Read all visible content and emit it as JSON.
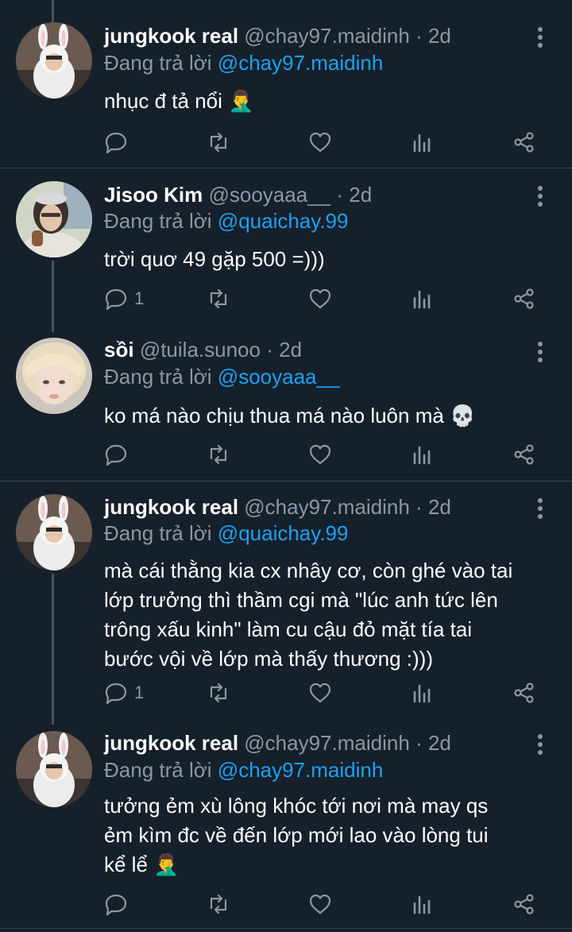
{
  "reply_prefix": "Đang trả lời",
  "tweets": [
    {
      "name": "jungkook real",
      "handle": "@chay97.maidinh",
      "time": "2d",
      "reply_to": "@chay97.maidinh",
      "text": "nhục đ tả nổi 🤦‍♂️",
      "reply_count": "",
      "avatar": "bunny-costume-boy"
    },
    {
      "name": "Jisoo Kim",
      "handle": "@sooyaaa__",
      "time": "2d",
      "reply_to": "@quaichay.99",
      "text": "trời quơ 49 gặp 500 =)))",
      "reply_count": "1",
      "avatar": "girl-with-hat"
    },
    {
      "name": "sồi",
      "handle": "@tuila.sunoo",
      "time": "2d",
      "reply_to": "@sooyaaa__",
      "text": "ko má nào chịu thua má nào luôn mà 💀",
      "reply_count": "",
      "avatar": "blond-boy"
    },
    {
      "name": "jungkook real",
      "handle": "@chay97.maidinh",
      "time": "2d",
      "reply_to": "@quaichay.99",
      "text": "mà cái thằng kia cx nhây cơ, còn ghé vào tai\nlớp trưởng thì thầm cgi mà \"lúc anh tức lên\ntrông xấu kinh\" làm cu cậu đỏ mặt tía tai\nbước vội về lớp mà thấy thương :)))",
      "reply_count": "1",
      "avatar": "bunny-costume-boy"
    },
    {
      "name": "jungkook real",
      "handle": "@chay97.maidinh",
      "time": "2d",
      "reply_to": "@chay97.maidinh",
      "text": "tưởng ẻm xù lông khóc tới nơi mà may qs\nẻm kìm đc về đến lớp mới lao vào lòng tui\nkể lể 🤦‍♂️",
      "reply_count": "",
      "avatar": "bunny-costume-boy"
    }
  ],
  "icons": [
    "reply-icon",
    "retweet-icon",
    "like-icon",
    "analytics-icon",
    "share-icon",
    "more-icon"
  ],
  "colors": {
    "background": "#15202b",
    "muted": "#8899a6",
    "mention": "#1da1f2",
    "thread_line": "#3d5466"
  }
}
